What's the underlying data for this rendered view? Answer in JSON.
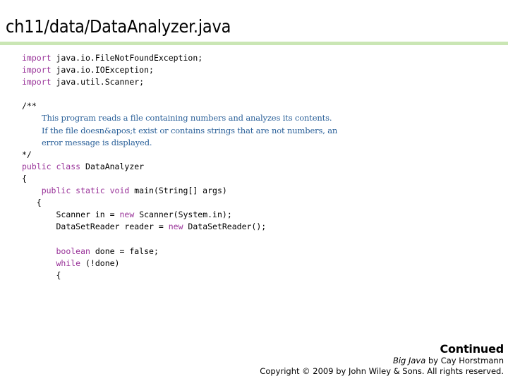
{
  "slide": {
    "title": "ch11/data/DataAnalyzer.java",
    "accent_color": "#cae6b4",
    "keyword_color": "#993399",
    "comment_color": "#2a6099",
    "background_color": "#ffffff"
  },
  "code": {
    "language": "java",
    "lines": [
      {
        "id": "line-1",
        "indent": "",
        "keyword": "import",
        "rest": " java.io.FileNotFoundException;"
      },
      {
        "id": "line-2",
        "indent": "",
        "keyword": "import",
        "rest": " java.io.IOException;"
      },
      {
        "id": "line-3",
        "indent": "",
        "keyword": "import",
        "rest": " java.util.Scanner;"
      },
      {
        "id": "line-4",
        "blank": true
      },
      {
        "id": "line-5",
        "indent": "",
        "keyword": "",
        "rest": "/**"
      },
      {
        "id": "line-6",
        "doc": true,
        "text": "This program reads a file containing numbers and analyzes its contents."
      },
      {
        "id": "line-7",
        "doc": true,
        "text": "If the file doesn&apos;t exist or contains strings that are not numbers, an"
      },
      {
        "id": "line-8",
        "doc": true,
        "text": "error message is displayed."
      },
      {
        "id": "line-9",
        "indent": "",
        "keyword": "",
        "rest": "*/"
      },
      {
        "id": "line-10",
        "indent": "",
        "keyword": "public class",
        "rest": " DataAnalyzer"
      },
      {
        "id": "line-11",
        "indent": "",
        "keyword": "",
        "rest": "{"
      },
      {
        "id": "line-12",
        "indent": "    ",
        "keyword": "public static void",
        "rest": " main(String[] args)"
      },
      {
        "id": "line-13",
        "indent": "   ",
        "keyword": "",
        "rest": "{"
      },
      {
        "id": "line-14",
        "indent": "       ",
        "keyword": "",
        "rest": "Scanner in = ",
        "keyword2": "new",
        "rest2": " Scanner(System.in);"
      },
      {
        "id": "line-15",
        "indent": "       ",
        "keyword": "",
        "rest": "DataSetReader reader = ",
        "keyword2": "new",
        "rest2": " DataSetReader();"
      },
      {
        "id": "line-16",
        "blank": true
      },
      {
        "id": "line-17",
        "indent": "       ",
        "keyword": "boolean",
        "rest": " done = false;"
      },
      {
        "id": "line-18",
        "indent": "       ",
        "keyword": "while",
        "rest": " (!done)"
      },
      {
        "id": "line-19",
        "indent": "       ",
        "keyword": "",
        "rest": "{"
      }
    ]
  },
  "footer": {
    "continued": "Continued",
    "book_title": "Big Java",
    "byline": " by Cay Horstmann",
    "copyright": "Copyright © 2009 by John Wiley & Sons.  All rights reserved."
  }
}
